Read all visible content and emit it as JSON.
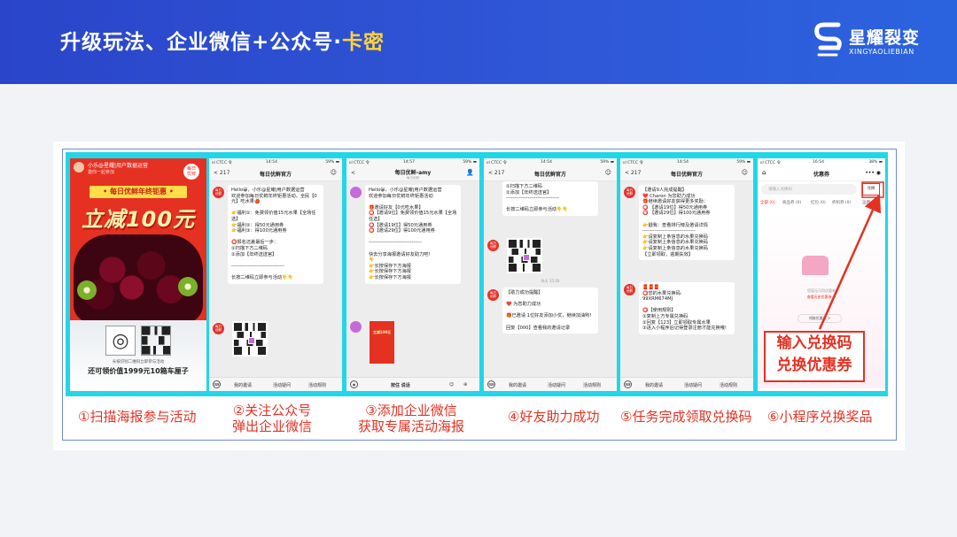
{
  "header": {
    "title_main": "升级玩法、企业微信+公众号·",
    "title_highlight": "卡密",
    "logo_cn": "星耀裂变",
    "logo_en": "XINGYAOLIEBIAN"
  },
  "poster": {
    "user": "小乐@星耀|用户数据运营",
    "invite": "邀你一起参加",
    "badge": "每日\n优鲜",
    "ribbon": "• 每日优鲜年终钜惠 •",
    "headline": "立减100元",
    "hint": "长按识别二维码立即参与活动",
    "footer": "还可领价值1999元10箱车厘子"
  },
  "chat1": {
    "status_carrier": "ııl CTCC 令",
    "status_time": "14:54",
    "status_battery": "59% ▬",
    "back": "< 217",
    "title": "每日优鲜官方",
    "more": "☺",
    "avatar": "每日\n优鲜",
    "message": "Hello😀，小乐@星耀|用户数据运营\n欢迎参加每日优鲜年终钜惠活动，全民【0元】吃水果🍎\n\n👉福利①：免费领价值15元水果【全场任选】\n👉福利②：得50元通用券\n👉福利③：得100元通用券\n\n⭕报名还差最后一步：\n①扫描下方二维码\n②添加【年终送送官】\n\n--------------------------------\n\n长按二维码立即参与活动👇👇",
    "bottom_items": [
      "我的邀请",
      "活动疑问",
      "活动规则"
    ]
  },
  "chat2": {
    "status_carrier": "ııl CTCC 令",
    "status_time": "14:57",
    "status_battery": "59% ▬",
    "back": "<",
    "title": "每日优鲜-amy",
    "subtitle": "每日优鲜",
    "more": "👤",
    "message": "Hello😀，小乐@星耀|用户数据运营\n欢迎参加每日优鲜年终钜惠活动\n\n🎁邀请好友【0元吃水果】\n⭕【邀请9位】免费领价值15元水果【全场任选】\n⭕【邀请19位】得50元通用券\n⭕【邀请29位】得100元通用券\n\n--------------------------------\n\n快去分享海报邀请好友助力吧!\n👇\n👉长按保存下方海报\n👉长按保存下方海报\n👉长按保存下方海报",
    "mini_poster": "立减100元",
    "bottom_center": "按住 说话"
  },
  "chat3": {
    "status_carrier": "ııl CTCC 令",
    "status_time": "14:54",
    "status_battery": "59% ▬",
    "back": "< 217",
    "title": "每日优鲜官方",
    "more": "☺",
    "avatar": "每日\n优鲜",
    "message_top": "①扫描下方二维码\n②添加【年终送送官】\n--------------------------------\n\n长按二维码立即参与活动👇👇",
    "time": "昨天 15:20",
    "message_bottom": "【助力成功提醒】\n\n❤️ 为您助力成功\n\n🎁已邀请 1位好友添加小优，继续加油哟!\n\n回复【000】查看我的邀请记录",
    "bottom_items": [
      "我的邀请",
      "活动疑问",
      "活动规则"
    ]
  },
  "chat4": {
    "status_carrier": "ııl CTCC 令",
    "status_time": "14:54",
    "status_battery": "59% ▬",
    "back": "< 217",
    "title": "每日优鲜官方",
    "more": "☺",
    "avatar": "每日\n优鲜",
    "message_top": "【邀请9人完成提醒】\n❤️ Charon 为您助力成功\n🎁继续邀请好友获得更多奖励：\n⭕ 【邀请19位】得50元通用券\n⭕ 【邀请29位】得100元通用券\n\n👉戳我：查看排行榜及邀请详情\n--------------------------------\n👉请复制上条信息的水果兑换码\n👉请复制上条信息的水果兑换码\n👉请复制上条信息的水果兑换码\n【立即领取，逾期失效】",
    "message_bottom": "🧧🧧🧧\n⭕您的水果兑换码:\n99XRM674MJ\n\n⭕【使用规则】\n①复制上方专属兑换码\n②回复【123】立即领取专属水果\n③进入小程序后记得登录注册才能兑换哦!",
    "bottom_items": [
      "我的邀请",
      "活动疑问",
      "活动规则"
    ]
  },
  "miniapp": {
    "status_carrier": "ııl CTCC 令",
    "status_time": "16:54",
    "status_battery": "38% ▬",
    "home": "⌂",
    "title": "优惠券",
    "menu": "••• ◉",
    "search_placeholder": "请输入兑换码",
    "redeem": "兑换",
    "tabs": [
      "全部 (0)",
      "商品券 (0)",
      "红包 (0)",
      "折扣券 (0)",
      "运费"
    ],
    "empty_text": "您暂无可用优惠券",
    "empty_link": "查看历史优惠券 >",
    "empty_button": "领取优惠券 >",
    "callout_line1": "输入兑换码",
    "callout_line2": "兑换优惠券"
  },
  "steps": [
    "①扫描海报参与活动",
    "②关注公众号\n弹出企业微信",
    "③添加企业微信\n获取专属活动海报",
    "④好友助力成功",
    "⑤任务完成领取兑换码",
    "⑥小程序兑换奖品"
  ],
  "colors": {
    "header": "#2f56d6",
    "accent": "#e53122",
    "frame": "#22d6e8",
    "highlight": "#ffd43a"
  }
}
